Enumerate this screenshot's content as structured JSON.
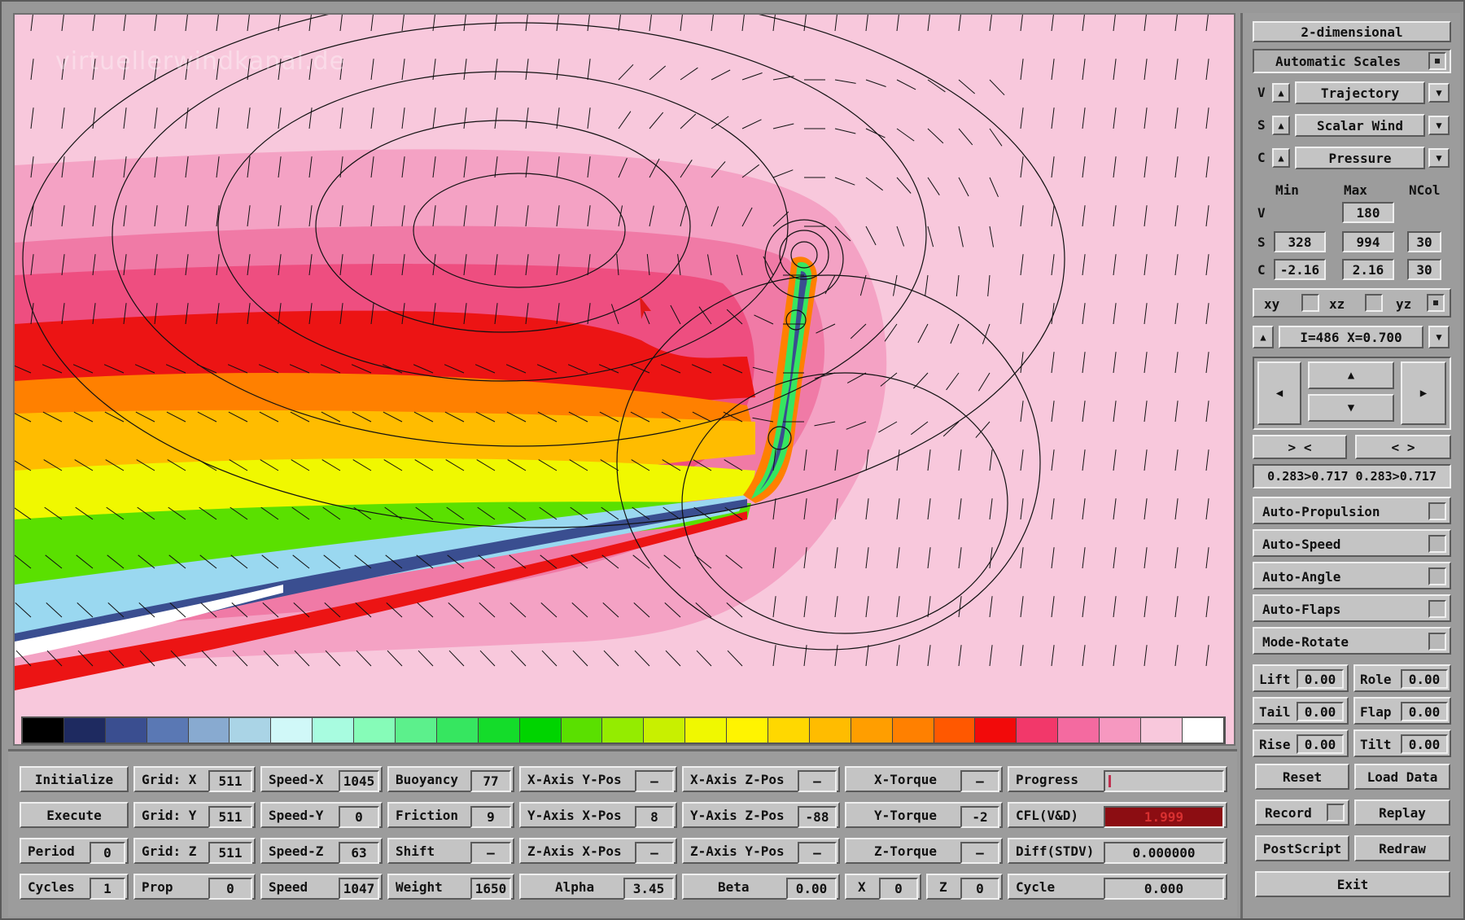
{
  "watermark": "virtuellerwindkanal.de",
  "colorbar": [
    "#000000",
    "#1e2a60",
    "#3a4e90",
    "#5a78b4",
    "#88aad0",
    "#aad4e6",
    "#d0f8f8",
    "#a8fce0",
    "#86fcb8",
    "#5cf08c",
    "#36e660",
    "#14dc2a",
    "#00d400",
    "#5ae000",
    "#94ec00",
    "#c8f000",
    "#f0f800",
    "#fff400",
    "#ffd800",
    "#ffbc00",
    "#ff9e00",
    "#ff8000",
    "#ff5800",
    "#f20a0a",
    "#f2386a",
    "#f46aa0",
    "#f698c0",
    "#f8c8dc",
    "#ffffff"
  ],
  "right": {
    "mode_button": "2-dimensional",
    "auto_scales": "Automatic Scales",
    "v_row": {
      "letter": "V",
      "value": "Trajectory"
    },
    "s_row": {
      "letter": "S",
      "value": "Scalar Wind"
    },
    "c_row": {
      "letter": "C",
      "value": "Pressure"
    },
    "table_headers": {
      "min": "Min",
      "max": "Max",
      "ncol": "NCol"
    },
    "table_v": {
      "label": "V",
      "max": "180"
    },
    "table_s": {
      "label": "S",
      "min": "328",
      "max": "994",
      "ncol": "30"
    },
    "table_c": {
      "label": "C",
      "min": "-2.16",
      "max": "2.16",
      "ncol": "30"
    },
    "planes": {
      "xy": "xy",
      "xz": "xz",
      "yz": "yz"
    },
    "slice": "I=486  X=0.700",
    "zoom_in": "> <",
    "zoom_out": "< >",
    "range": "0.283>0.717 0.283>0.717",
    "toggles": [
      "Auto-Propulsion",
      "Auto-Speed",
      "Auto-Angle",
      "Auto-Flaps",
      "Mode-Rotate"
    ],
    "controls": [
      {
        "name": "Lift",
        "value": "0.00"
      },
      {
        "name": "Role",
        "value": "0.00"
      },
      {
        "name": "Tail",
        "value": "0.00"
      },
      {
        "name": "Flap",
        "value": "0.00"
      },
      {
        "name": "Rise",
        "value": "0.00"
      },
      {
        "name": "Tilt",
        "value": "0.00"
      }
    ]
  },
  "bottom": {
    "initialize": "Initialize",
    "execute": "Execute",
    "period": {
      "name": "Period",
      "value": "0"
    },
    "cycles": {
      "name": "Cycles",
      "value": "1"
    },
    "grid_x": {
      "name": "Grid: X",
      "value": "511"
    },
    "grid_y": {
      "name": "Grid: Y",
      "value": "511"
    },
    "grid_z": {
      "name": "Grid: Z",
      "value": "511"
    },
    "prop": {
      "name": "Prop",
      "value": "0"
    },
    "speed_x": {
      "name": "Speed-X",
      "value": "1045"
    },
    "speed_y": {
      "name": "Speed-Y",
      "value": "0"
    },
    "speed_z": {
      "name": "Speed-Z",
      "value": "63"
    },
    "speed": {
      "name": "Speed",
      "value": "1047"
    },
    "buoyancy": {
      "name": "Buoyancy",
      "value": "77"
    },
    "friction": {
      "name": "Friction",
      "value": "9"
    },
    "shift": {
      "name": "Shift",
      "value": "—"
    },
    "weight": {
      "name": "Weight",
      "value": "1650"
    },
    "x_axis_y_pos": {
      "name": "X-Axis Y-Pos",
      "value": "—"
    },
    "y_axis_x_pos": {
      "name": "Y-Axis X-Pos",
      "value": "8"
    },
    "z_axis_x_pos": {
      "name": "Z-Axis X-Pos",
      "value": "—"
    },
    "alpha": {
      "name": "Alpha",
      "value": "3.45"
    },
    "x_axis_z_pos": {
      "name": "X-Axis Z-Pos",
      "value": "—"
    },
    "y_axis_z_pos": {
      "name": "Y-Axis Z-Pos",
      "value": "-88"
    },
    "z_axis_y_pos": {
      "name": "Z-Axis Y-Pos",
      "value": "—"
    },
    "beta": {
      "name": "Beta",
      "value": "0.00"
    },
    "x_torque": {
      "name": "X-Torque",
      "value": "—"
    },
    "y_torque": {
      "name": "Y-Torque",
      "value": "-2"
    },
    "z_torque": {
      "name": "Z-Torque",
      "value": "—"
    },
    "x": {
      "name": "X",
      "value": "0"
    },
    "z": {
      "name": "Z",
      "value": "0"
    },
    "progress": {
      "name": "Progress",
      "fraction": 0.01
    },
    "cfl": {
      "name": "CFL(V&D)",
      "value": "1.999",
      "color": "#8c0d12"
    },
    "diff": {
      "name": "Diff(STDV)",
      "value": "0.000000"
    },
    "cycle": {
      "name": "Cycle",
      "value": "0.000"
    }
  },
  "actions": {
    "reset": "Reset",
    "load_data": "Load Data",
    "record": "Record",
    "replay": "Replay",
    "postscript": "PostScript",
    "redraw": "Redraw",
    "exit": "Exit"
  }
}
